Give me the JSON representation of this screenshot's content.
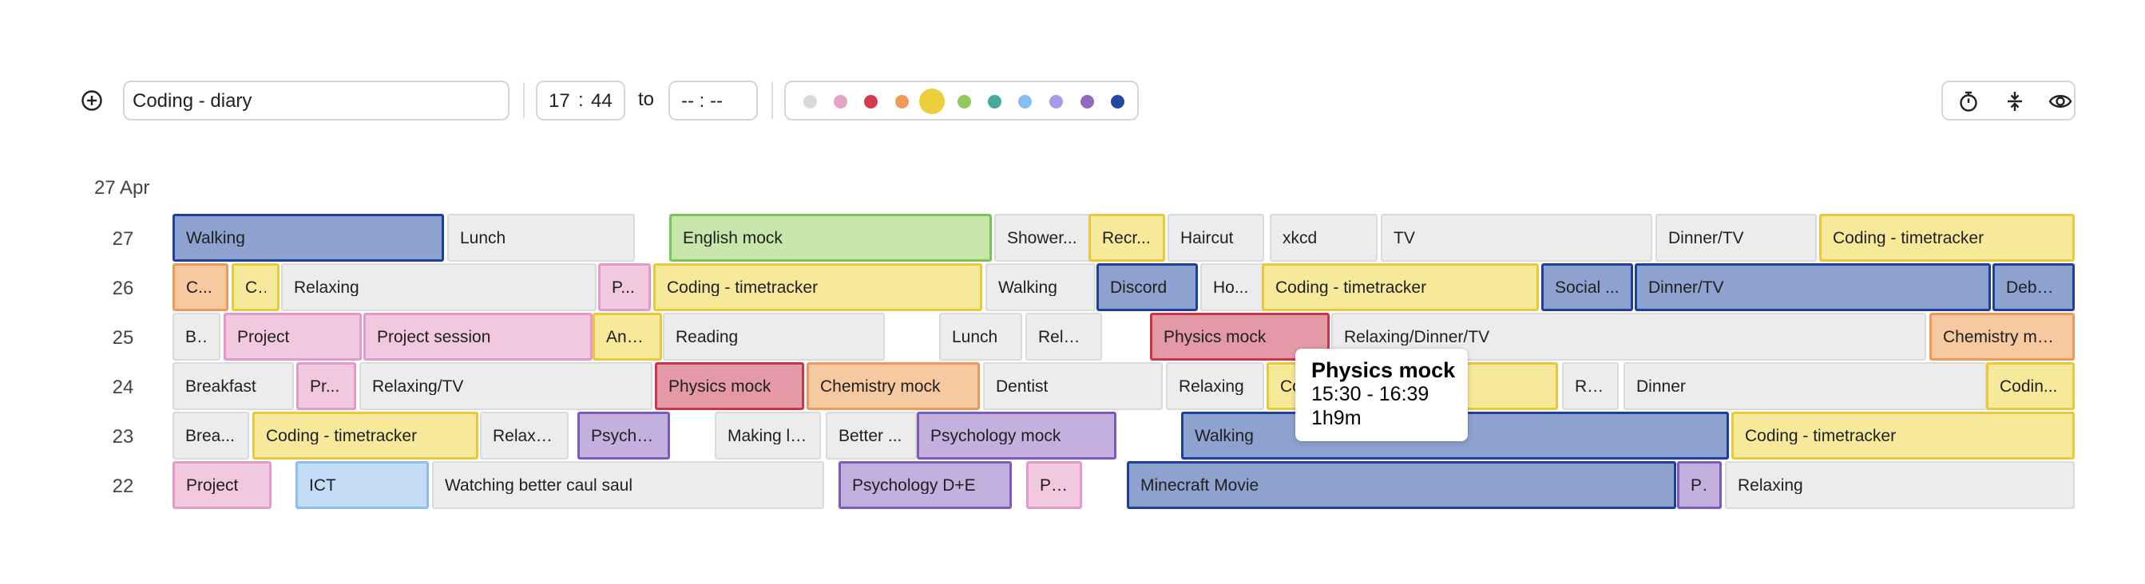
{
  "toolbar": {
    "task_name": "Coding - diary",
    "start_hour": "17",
    "start_minute": "44",
    "time_colon": ":",
    "to_label": "to",
    "end_placeholder": "-- : --",
    "colors": [
      "#d9d9d9",
      "#e5a3c7",
      "#d43a4e",
      "#f0995a",
      "#eccd3c",
      "#92c95e",
      "#4aa89b",
      "#86bdf2",
      "#a79ae9",
      "#8c6bc0",
      "#2347a0"
    ],
    "selected_color": "#eccd3c",
    "icons": {
      "add": "plus-circle-icon",
      "timer": "stopwatch-icon",
      "compress": "collapse-rows-icon",
      "visibility": "eye-icon"
    }
  },
  "date_header": "27 Apr",
  "days": [
    {
      "label": "27",
      "blocks": [
        {
          "text": "Walking",
          "color": "blue"
        },
        {
          "text": "Lunch",
          "color": "gray"
        },
        {
          "text": "English mock",
          "color": "green"
        },
        {
          "text": "Shower...",
          "color": "gray"
        },
        {
          "text": "Recr...",
          "color": "yellow"
        },
        {
          "text": "Haircut",
          "color": "gray"
        },
        {
          "text": "xkcd",
          "color": "gray"
        },
        {
          "text": "TV",
          "color": "gray"
        },
        {
          "text": "Dinner/TV",
          "color": "gray"
        },
        {
          "text": "Coding - timetracker",
          "color": "yellow"
        }
      ]
    },
    {
      "label": "26",
      "blocks": [
        {
          "text": "C...",
          "color": "orange"
        },
        {
          "text": "C...",
          "color": "yellow"
        },
        {
          "text": "Relaxing",
          "color": "gray"
        },
        {
          "text": "P...",
          "color": "pink"
        },
        {
          "text": "Coding - timetracker",
          "color": "yellow"
        },
        {
          "text": "Walking",
          "color": "gray"
        },
        {
          "text": "Discord",
          "color": "blue"
        },
        {
          "text": "Ho...",
          "color": "gray"
        },
        {
          "text": "Coding - timetracker",
          "color": "yellow"
        },
        {
          "text": "Social ...",
          "color": "blue"
        },
        {
          "text": "Dinner/TV",
          "color": "blue"
        },
        {
          "text": "Debat...",
          "color": "blue"
        }
      ]
    },
    {
      "label": "25",
      "blocks": [
        {
          "text": "B...",
          "color": "gray"
        },
        {
          "text": "Project",
          "color": "pink"
        },
        {
          "text": "Project session",
          "color": "pink"
        },
        {
          "text": "And...",
          "color": "yellow"
        },
        {
          "text": "Reading",
          "color": "gray"
        },
        {
          "text": "Lunch",
          "color": "gray"
        },
        {
          "text": "Relax...",
          "color": "gray"
        },
        {
          "text": "Physics mock",
          "color": "red"
        },
        {
          "text": "Relaxing/Dinner/TV",
          "color": "gray"
        },
        {
          "text": "Chemistry mock",
          "color": "orange"
        }
      ]
    },
    {
      "label": "24",
      "blocks": [
        {
          "text": "Breakfast",
          "color": "gray"
        },
        {
          "text": "Pr...",
          "color": "pink"
        },
        {
          "text": "Relaxing/TV",
          "color": "gray"
        },
        {
          "text": "Physics mock",
          "color": "red"
        },
        {
          "text": "Chemistry mock",
          "color": "orange"
        },
        {
          "text": "Dentist",
          "color": "gray"
        },
        {
          "text": "Relaxing",
          "color": "gray"
        },
        {
          "text": "Co...",
          "color": "yellow"
        },
        {
          "text": "Rel...",
          "color": "gray"
        },
        {
          "text": "Dinner",
          "color": "gray"
        },
        {
          "text": "Codin...",
          "color": "yellow"
        }
      ]
    },
    {
      "label": "23",
      "blocks": [
        {
          "text": "Brea...",
          "color": "gray"
        },
        {
          "text": "Coding - timetracker",
          "color": "yellow"
        },
        {
          "text": "Relaxing",
          "color": "gray"
        },
        {
          "text": "Psycho...",
          "color": "purple"
        },
        {
          "text": "Making lu...",
          "color": "gray"
        },
        {
          "text": "Better ...",
          "color": "gray"
        },
        {
          "text": "Psychology mock",
          "color": "purple"
        },
        {
          "text": "Walking",
          "color": "blue"
        },
        {
          "text": "Coding - timetracker",
          "color": "yellow"
        }
      ]
    },
    {
      "label": "22",
      "blocks": [
        {
          "text": "Project",
          "color": "pink"
        },
        {
          "text": "ICT",
          "color": "lightblue"
        },
        {
          "text": "Watching better caul saul",
          "color": "gray"
        },
        {
          "text": "Psychology D+E",
          "color": "purple"
        },
        {
          "text": "Pr...",
          "color": "pink"
        },
        {
          "text": "Minecraft Movie",
          "color": "blue"
        },
        {
          "text": "Ps.",
          "color": "purple"
        },
        {
          "text": "Relaxing",
          "color": "gray"
        }
      ]
    }
  ],
  "tooltip": {
    "title": "Physics mock",
    "range": "15:30 - 16:39",
    "duration": "1h9m"
  }
}
